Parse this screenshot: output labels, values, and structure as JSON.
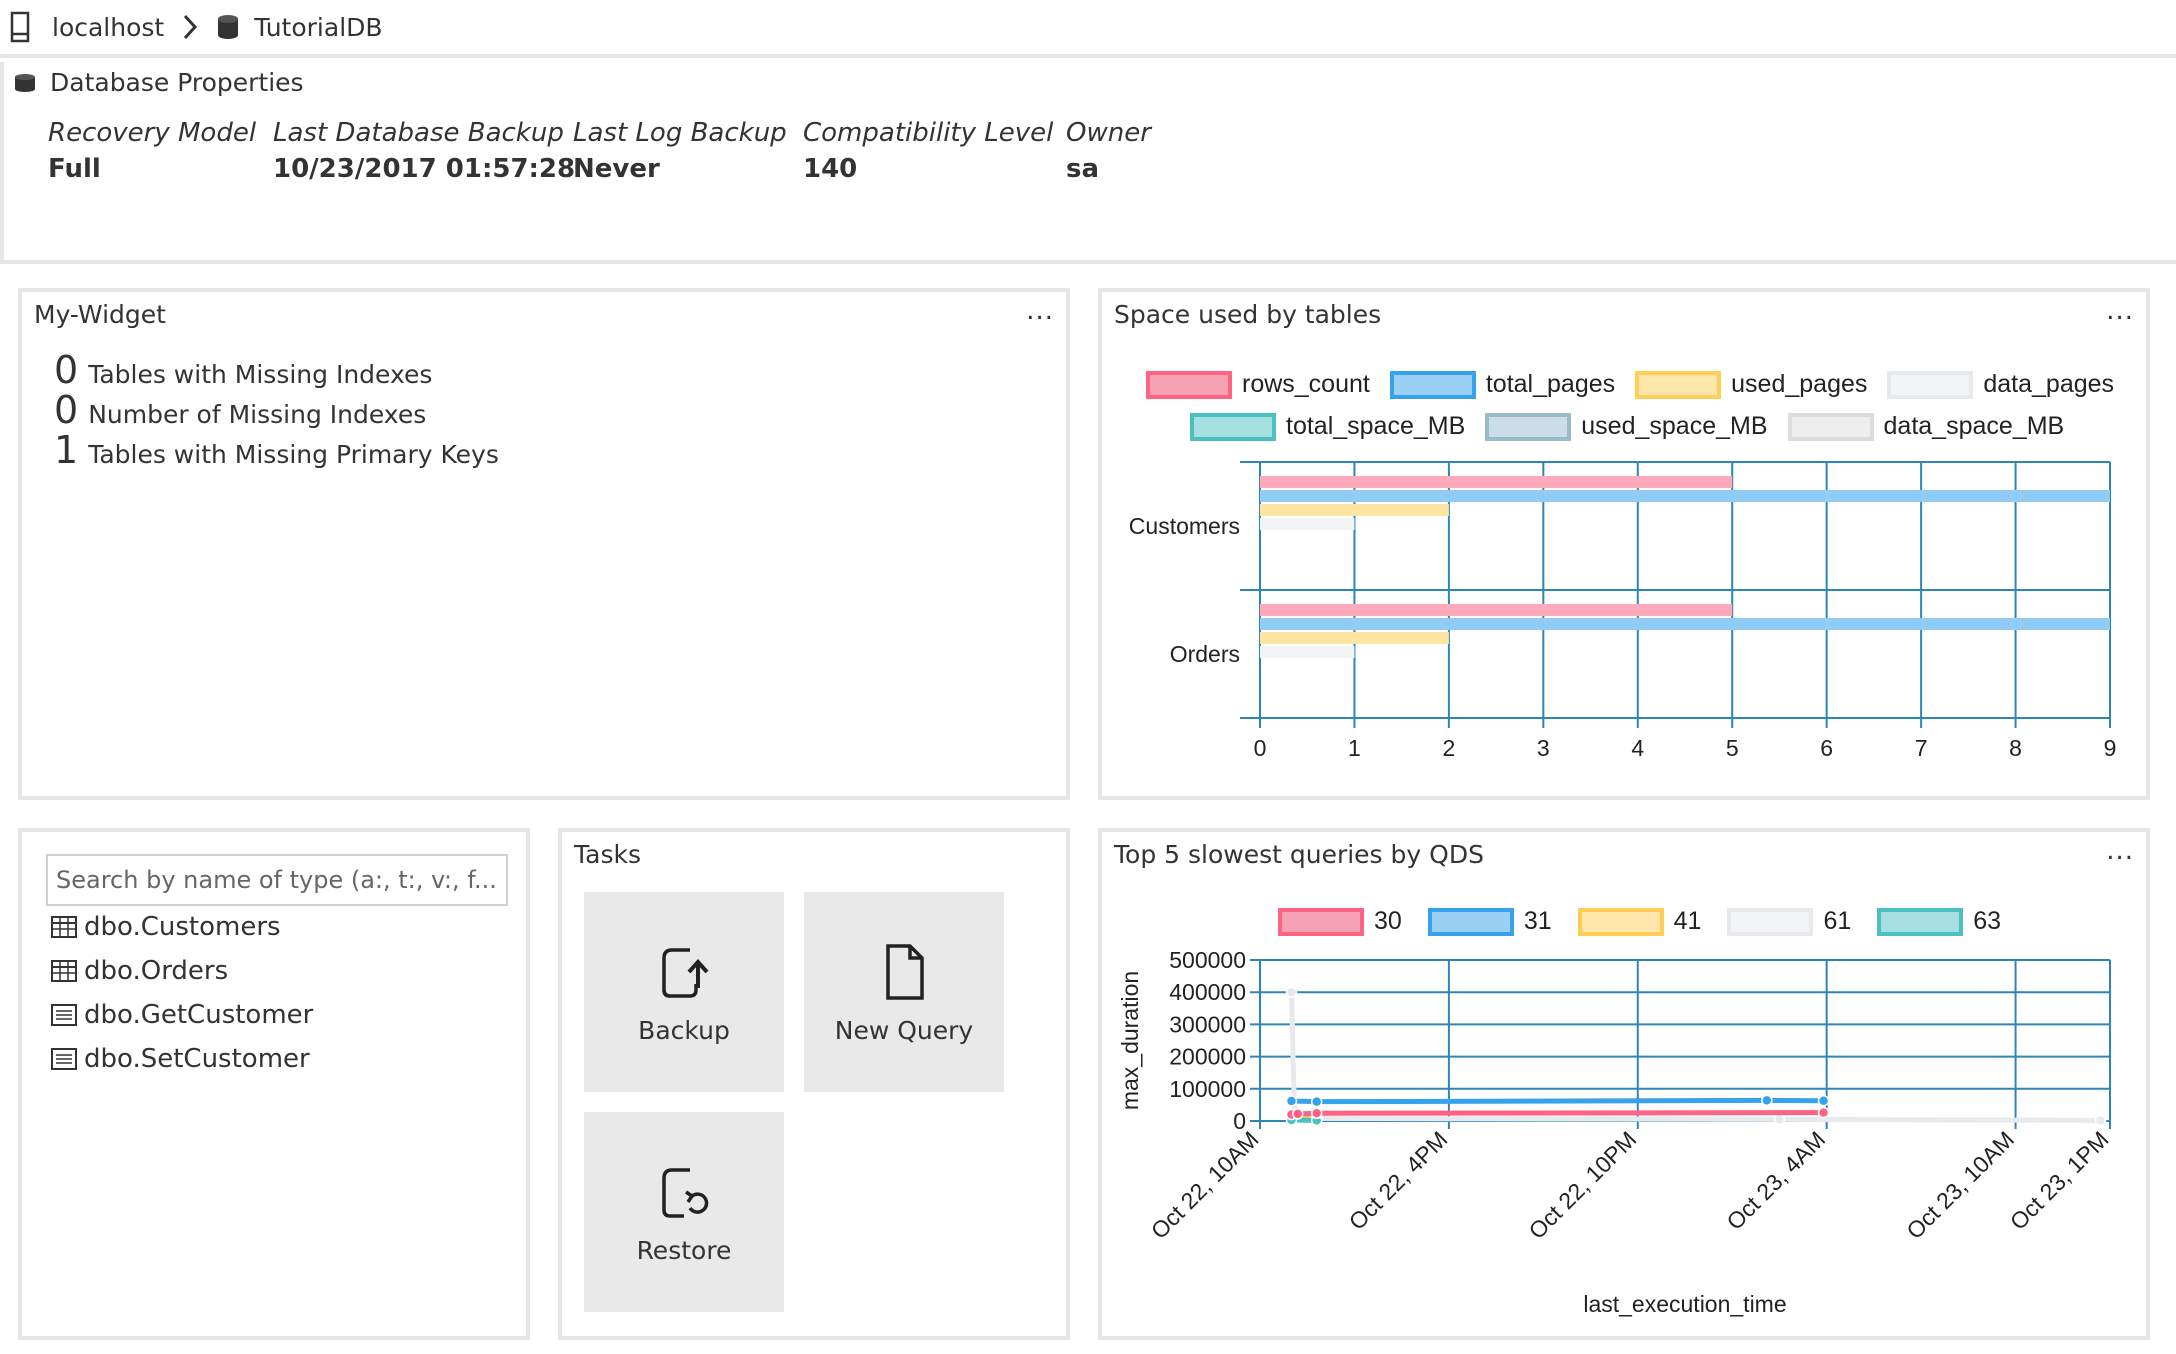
{
  "breadcrumb": {
    "server": "localhost",
    "database": "TutorialDB"
  },
  "properties": {
    "title": "Database Properties",
    "items": [
      {
        "label": "Recovery Model",
        "value": "Full"
      },
      {
        "label": "Last Database Backup",
        "value": "10/23/2017 01:57:28"
      },
      {
        "label": "Last Log Backup",
        "value": "Never"
      },
      {
        "label": "Compatibility Level",
        "value": "140"
      },
      {
        "label": "Owner",
        "value": "sa"
      }
    ]
  },
  "my_widget": {
    "title": "My-Widget",
    "menu": "...",
    "metrics": [
      {
        "count": "0",
        "label": "Tables with Missing Indexes"
      },
      {
        "count": "0",
        "label": "Number of Missing Indexes"
      },
      {
        "count": "1",
        "label": "Tables with Missing Primary Keys"
      }
    ]
  },
  "explorer": {
    "search_placeholder": "Search by name of type (a:, t:, v:, f...",
    "items": [
      {
        "name": "dbo.Customers",
        "icon": "table-icon"
      },
      {
        "name": "dbo.Orders",
        "icon": "table-icon"
      },
      {
        "name": "dbo.GetCustomer",
        "icon": "stored-procedure-icon"
      },
      {
        "name": "dbo.SetCustomer",
        "icon": "stored-procedure-icon"
      }
    ]
  },
  "tasks": {
    "title": "Tasks",
    "items": [
      {
        "label": "Backup",
        "icon": "backup-icon"
      },
      {
        "label": "New Query",
        "icon": "new-query-icon"
      },
      {
        "label": "Restore",
        "icon": "restore-icon"
      }
    ]
  },
  "chart_data": [
    {
      "type": "bar",
      "orientation": "horizontal",
      "title": "Space used by tables",
      "menu": "...",
      "categories": [
        "Customers",
        "Orders"
      ],
      "xlim": [
        0,
        9
      ],
      "xticks": [
        "0",
        "1",
        "2",
        "3",
        "4",
        "5",
        "6",
        "7",
        "8",
        "9"
      ],
      "grid": true,
      "legend_position": "top",
      "series": [
        {
          "name": "rows_count",
          "values": [
            5,
            5
          ],
          "color": "#ff6384"
        },
        {
          "name": "total_pages",
          "values": [
            9,
            9
          ],
          "color": "#36a2eb"
        },
        {
          "name": "used_pages",
          "values": [
            2,
            2
          ],
          "color": "#ffce56"
        },
        {
          "name": "data_pages",
          "values": [
            1,
            1
          ],
          "color": "#e7e9ed"
        },
        {
          "name": "total_space_MB",
          "values": [
            0,
            0
          ],
          "color": "#4bc0c0"
        },
        {
          "name": "used_space_MB",
          "values": [
            0,
            0
          ],
          "color": "#97bbcd"
        },
        {
          "name": "data_space_MB",
          "values": [
            0,
            0
          ],
          "color": "#dcdcdc"
        }
      ]
    },
    {
      "type": "line",
      "title": "Top 5 slowest queries by QDS",
      "menu": "...",
      "xlabel": "last_execution_time",
      "ylabel": "max_duration",
      "ylim": [
        0,
        500000
      ],
      "yticks": [
        "0",
        "100000",
        "200000",
        "300000",
        "400000",
        "500000"
      ],
      "xticks": [
        "Oct 22, 10AM",
        "Oct 22, 4PM",
        "Oct 22, 10PM",
        "Oct 23, 4AM",
        "Oct 23, 10AM",
        "Oct 23, 1PM"
      ],
      "xrange_hours": [
        0,
        27
      ],
      "grid": true,
      "legend_position": "top",
      "series": [
        {
          "name": "30",
          "color": "#ff6384",
          "points": [
            [
              1.0,
              20000
            ],
            [
              1.2,
              22000
            ],
            [
              1.8,
              24000
            ],
            [
              17.9,
              26000
            ]
          ]
        },
        {
          "name": "31",
          "color": "#36a2eb",
          "points": [
            [
              1.0,
              62000
            ],
            [
              1.8,
              60000
            ],
            [
              16.1,
              64000
            ],
            [
              17.9,
              63000
            ]
          ]
        },
        {
          "name": "41",
          "color": "#ffce56",
          "points": [
            [
              1.0,
              10000
            ],
            [
              1.8,
              8000
            ]
          ]
        },
        {
          "name": "61",
          "color": "#e7e9ed",
          "points": [
            [
              1.0,
              400000
            ],
            [
              1.1,
              8000
            ],
            [
              16.5,
              5000
            ],
            [
              26.7,
              2000
            ]
          ]
        },
        {
          "name": "63",
          "color": "#4bc0c0",
          "points": [
            [
              1.0,
              3000
            ],
            [
              1.8,
              2000
            ]
          ]
        }
      ]
    }
  ]
}
